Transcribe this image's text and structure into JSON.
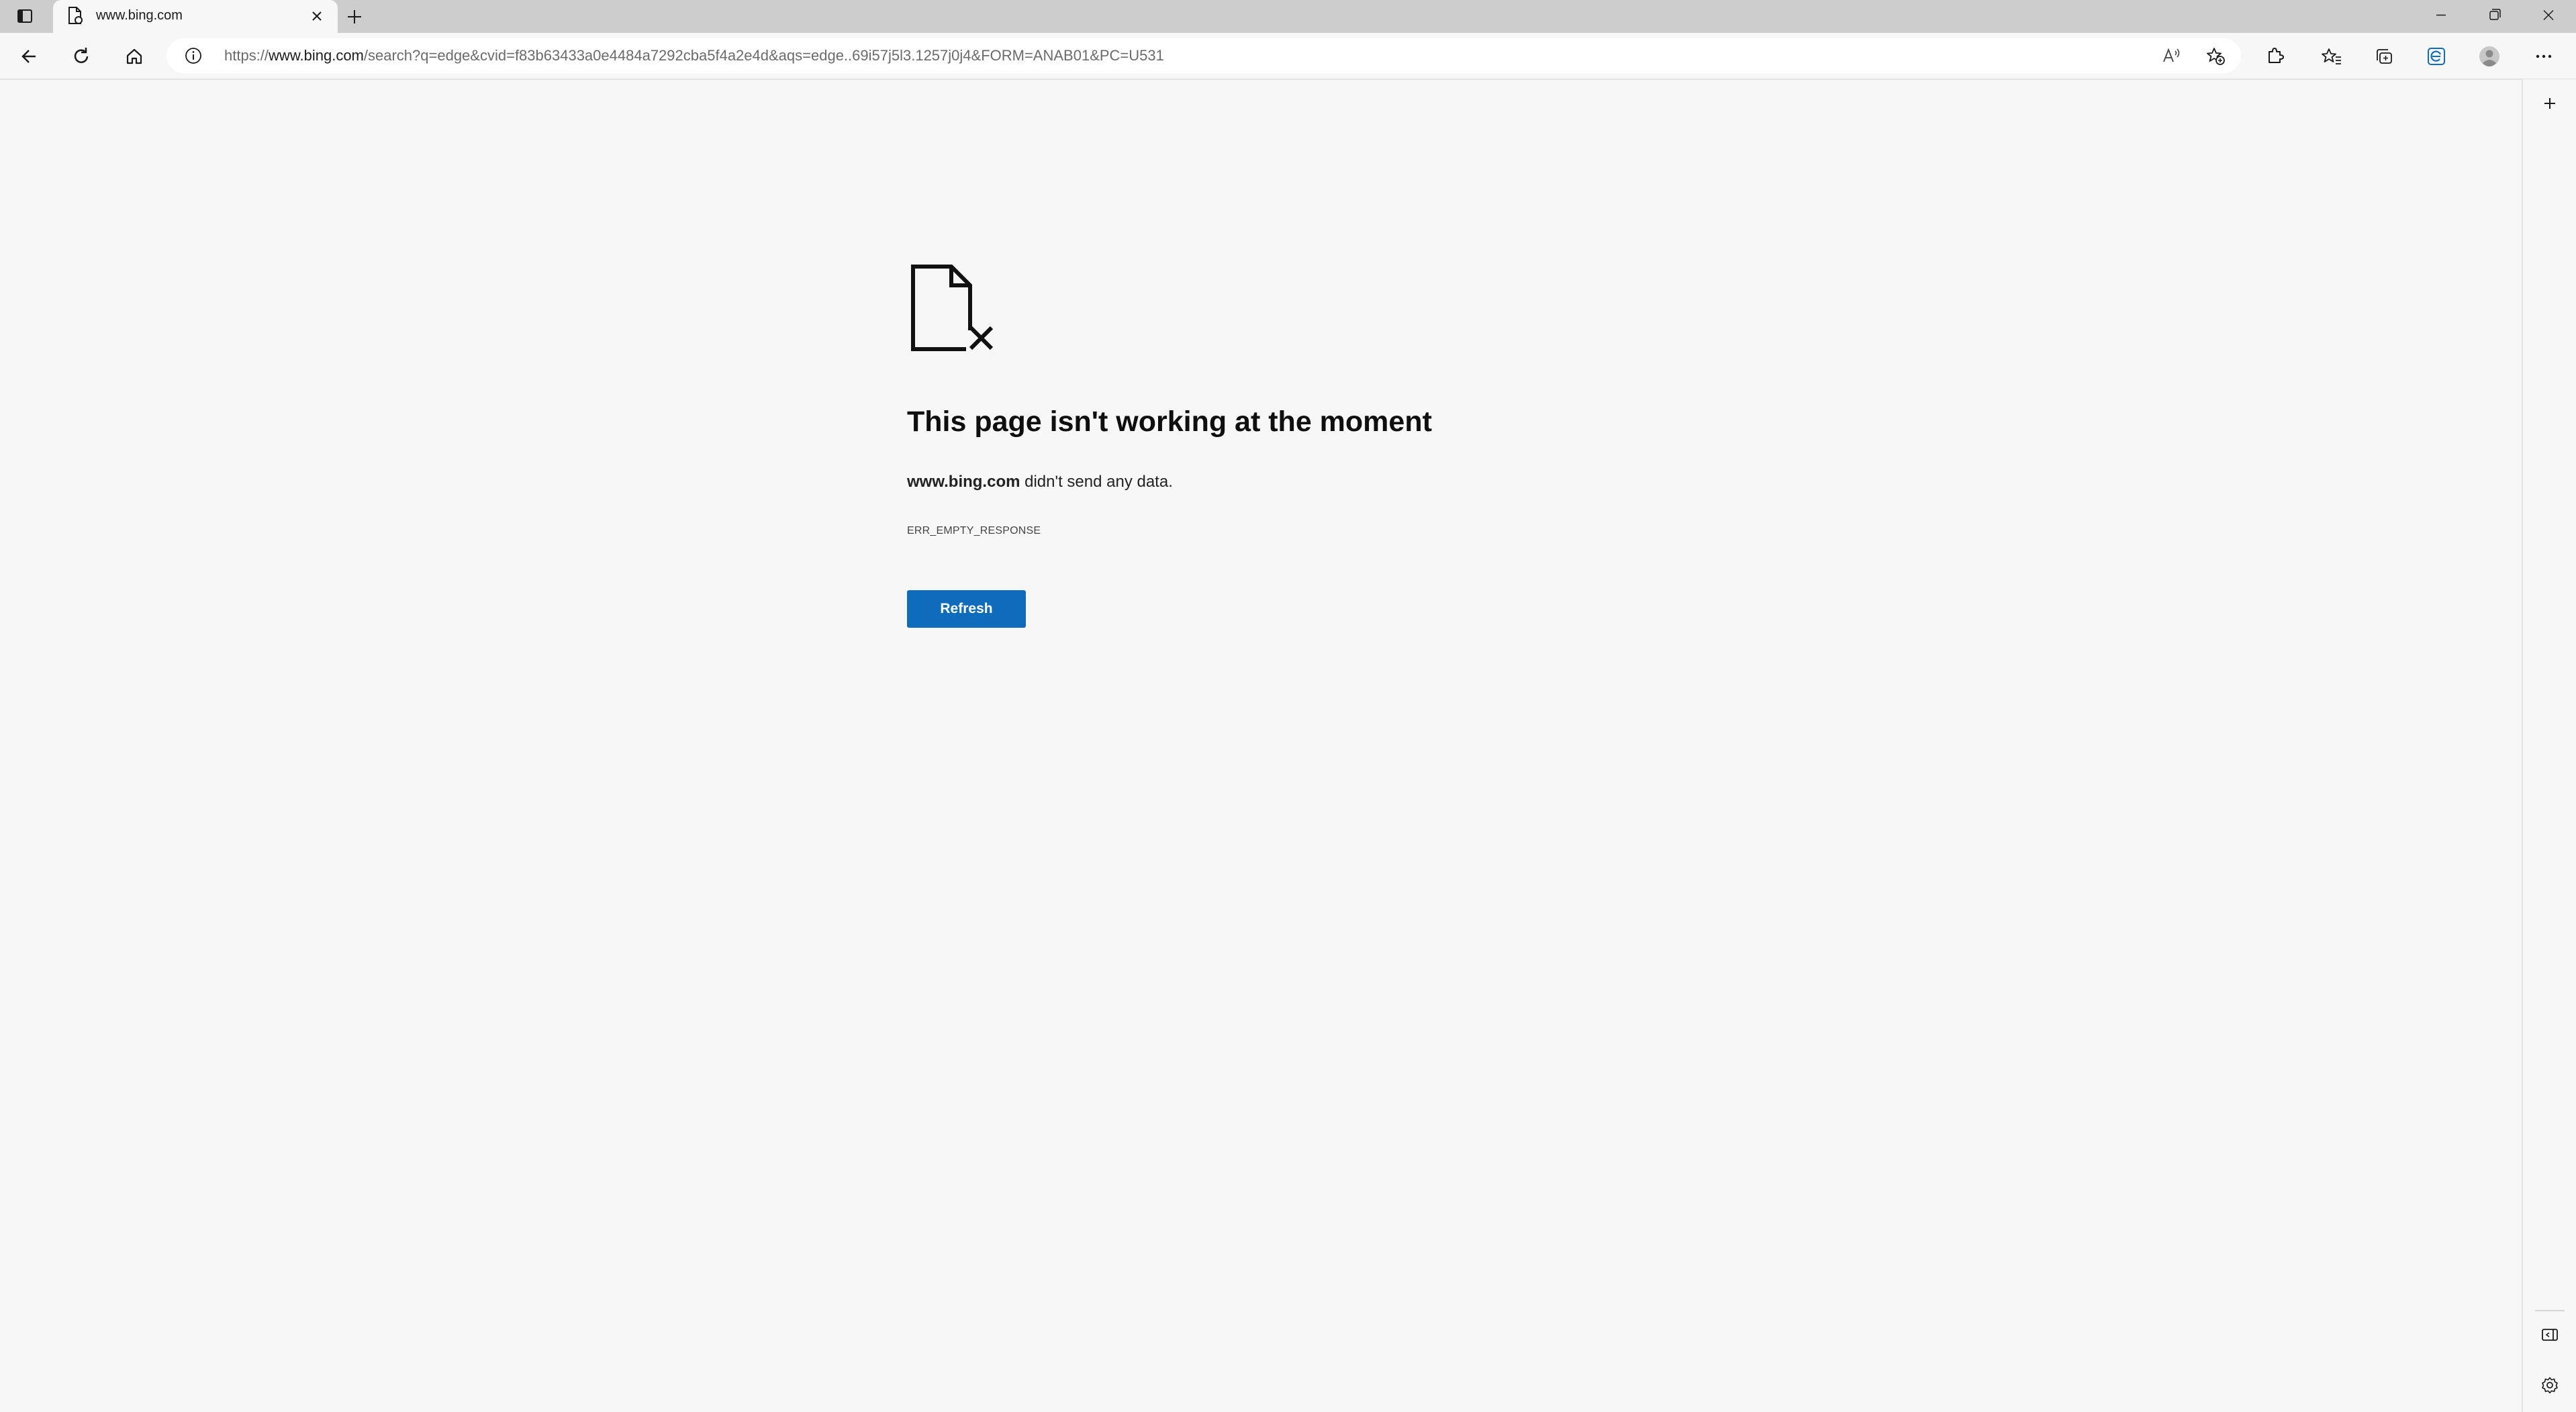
{
  "browser": {
    "tab": {
      "title": "www.bing.com"
    },
    "address": {
      "url_prefix": "https://",
      "url_host": "www.bing.com",
      "url_rest": "/search?q=edge&cvid=f83b63433a0e4484a7292cba5f4a2e4d&aqs=edge..69i57j5l3.1257j0j4&FORM=ANAB01&PC=U531"
    },
    "accent_color": "#0f6cbd"
  },
  "error": {
    "title": "This page isn't working at the moment",
    "host": "www.bing.com",
    "message_suffix": " didn't send any data.",
    "code": "ERR_EMPTY_RESPONSE",
    "refresh_label": "Refresh"
  },
  "icons": [
    "tab-actions-icon",
    "page-favicon-icon",
    "close-icon",
    "plus-icon",
    "minimize-icon",
    "restore-icon",
    "window-close-icon",
    "back-icon",
    "refresh-icon",
    "home-icon",
    "info-icon",
    "read-aloud-icon",
    "add-favorite-icon",
    "extensions-icon",
    "favorites-icon",
    "collections-icon",
    "browser-essentials-icon",
    "profile-avatar-icon",
    "more-icon",
    "sidebar-add-icon",
    "hide-sidebar-icon",
    "sidebar-settings-icon",
    "broken-document-icon"
  ]
}
